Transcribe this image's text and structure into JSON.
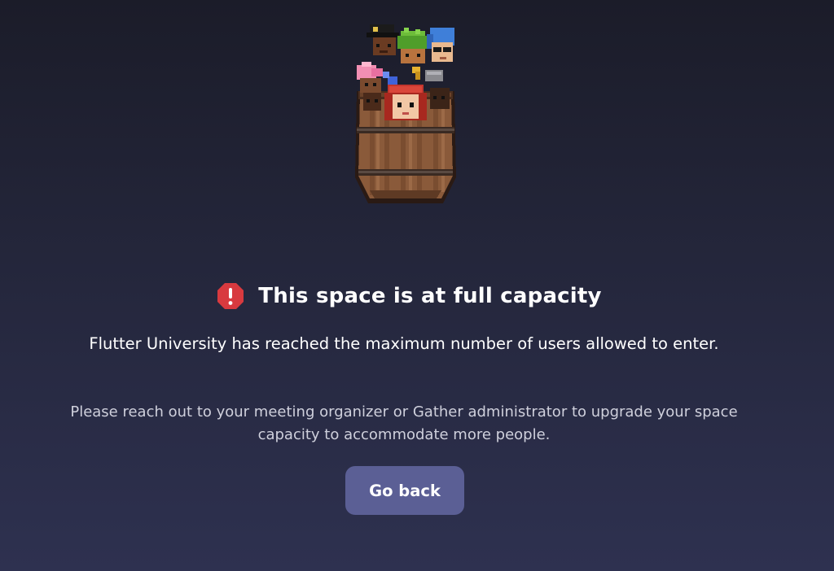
{
  "illustration": {
    "icon": "barrel-of-avatars-illustration"
  },
  "heading": {
    "icon": "alert-octagon-icon",
    "icon_color": "#d83a3f",
    "title": "This space is at full capacity"
  },
  "message": "Flutter University has reached the maximum number of users allowed to enter.",
  "submessage": "Please reach out to your meeting organizer or Gather administrator to upgrade your space capacity to accommodate more people.",
  "actions": {
    "go_back_label": "Go back",
    "button_color": "#5b5f95"
  }
}
